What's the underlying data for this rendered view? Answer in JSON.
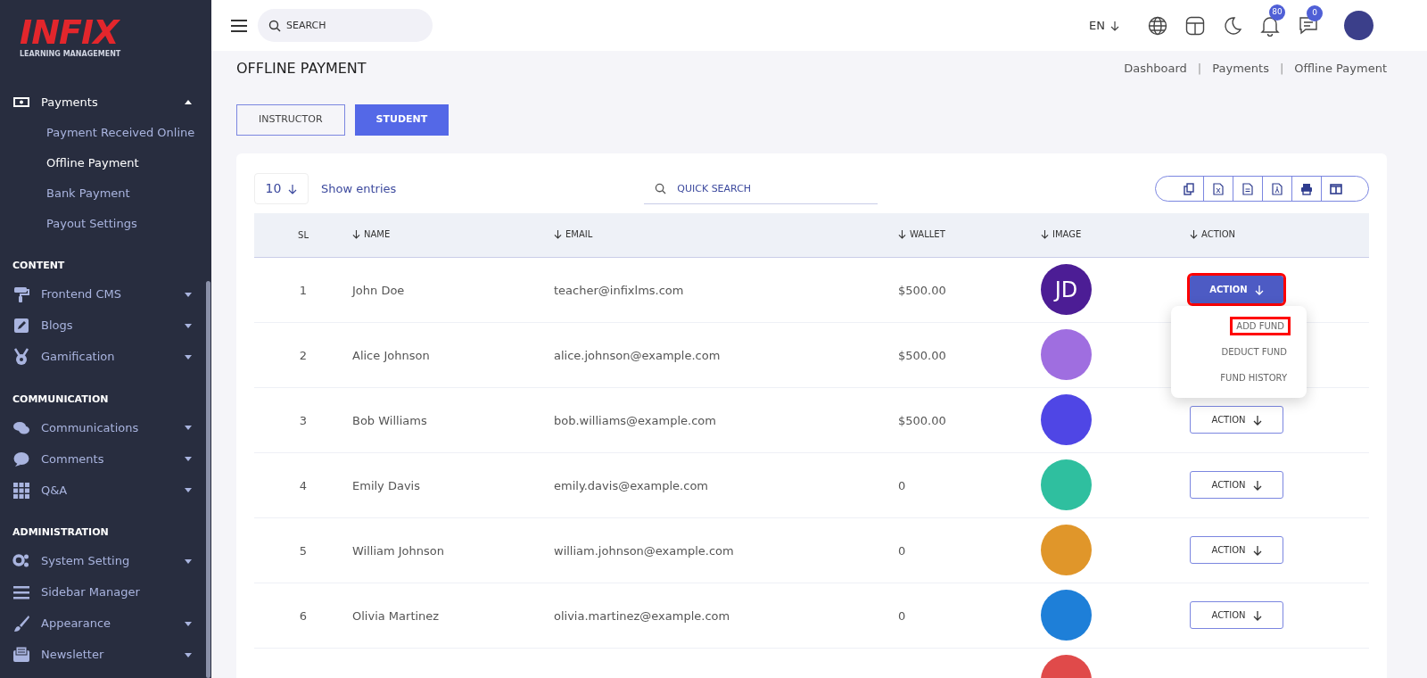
{
  "sidebar": {
    "logo": {
      "brand": "INFIX",
      "tagline": "LEARNING MANAGEMENT"
    },
    "groups": [
      {
        "items": [
          {
            "label": "Payments",
            "expanded": true,
            "children": [
              {
                "label": "Payment Received Online",
                "selected": false
              },
              {
                "label": "Offline Payment",
                "selected": true
              },
              {
                "label": "Bank Payment",
                "selected": false
              },
              {
                "label": "Payout Settings",
                "selected": false
              }
            ]
          }
        ]
      },
      {
        "heading": "CONTENT",
        "items": [
          {
            "label": "Frontend CMS",
            "expanded": false
          },
          {
            "label": "Blogs",
            "expanded": false
          },
          {
            "label": "Gamification",
            "expanded": false
          }
        ]
      },
      {
        "heading": "COMMUNICATION",
        "items": [
          {
            "label": "Communications",
            "expanded": false
          },
          {
            "label": "Comments",
            "expanded": false
          },
          {
            "label": "Q&A",
            "expanded": false
          }
        ]
      },
      {
        "heading": "ADMINISTRATION",
        "items": [
          {
            "label": "System Setting",
            "expanded": false
          },
          {
            "label": "Sidebar Manager"
          },
          {
            "label": "Appearance",
            "expanded": false
          },
          {
            "label": "Newsletter",
            "expanded": false
          }
        ]
      }
    ]
  },
  "topbar": {
    "search": {
      "placeholder": "SEARCH"
    },
    "language": "EN",
    "notifications_count": "80",
    "messages_count": "0"
  },
  "page": {
    "title": "OFFLINE PAYMENT",
    "breadcrumb": [
      "Dashboard",
      "|",
      "Payments",
      "|",
      "Offline Payment"
    ]
  },
  "tabs": [
    {
      "label": "INSTRUCTOR",
      "selected": false
    },
    {
      "label": "STUDENT",
      "selected": true
    }
  ],
  "table_controls": {
    "page_size": "10",
    "page_size_label": "Show entries",
    "search": {
      "placeholder": "QUICK SEARCH"
    }
  },
  "table": {
    "columns": [
      "SL",
      "NAME",
      "EMAIL",
      "WALLET",
      "IMAGE",
      "ACTION"
    ],
    "rows": [
      {
        "sl": "1",
        "name": "John Doe",
        "email": "teacher@infixlms.com",
        "wallet": "$500.00",
        "image": {
          "kind": "initials",
          "text": "JD",
          "color": "#4c1d95"
        },
        "action": {
          "label": "ACTION",
          "open": true,
          "highlighted": true
        }
      },
      {
        "sl": "2",
        "name": "Alice Johnson",
        "email": "alice.johnson@example.com",
        "wallet": "$500.00",
        "image": {
          "kind": "photo",
          "color": "#9f6ee0"
        }
      },
      {
        "sl": "3",
        "name": "Bob Williams",
        "email": "bob.williams@example.com",
        "wallet": "$500.00",
        "image": {
          "kind": "photo",
          "color": "#4f46e5"
        },
        "action": {
          "label": "ACTION",
          "open": false,
          "highlighted": false
        }
      },
      {
        "sl": "4",
        "name": "Emily Davis",
        "email": "emily.davis@example.com",
        "wallet": "0",
        "image": {
          "kind": "photo",
          "color": "#2fbf9f"
        },
        "action": {
          "label": "ACTION",
          "open": false,
          "highlighted": false
        }
      },
      {
        "sl": "5",
        "name": "William Johnson",
        "email": "william.johnson@example.com",
        "wallet": "0",
        "image": {
          "kind": "photo",
          "color": "#e0962a"
        },
        "action": {
          "label": "ACTION",
          "open": false,
          "highlighted": false
        }
      },
      {
        "sl": "6",
        "name": "Olivia Martinez",
        "email": "olivia.martinez@example.com",
        "wallet": "0",
        "image": {
          "kind": "photo",
          "color": "#1e7fd8"
        },
        "action": {
          "label": "ACTION",
          "open": false,
          "highlighted": false
        }
      },
      {
        "image": {
          "kind": "photo",
          "color": "#e04a4a"
        }
      }
    ]
  },
  "action_menu": {
    "items": [
      {
        "label": "ADD FUND",
        "highlighted": true
      },
      {
        "label": "DEDUCT FUND",
        "highlighted": false
      },
      {
        "label": "FUND HISTORY",
        "highlighted": false
      }
    ]
  }
}
